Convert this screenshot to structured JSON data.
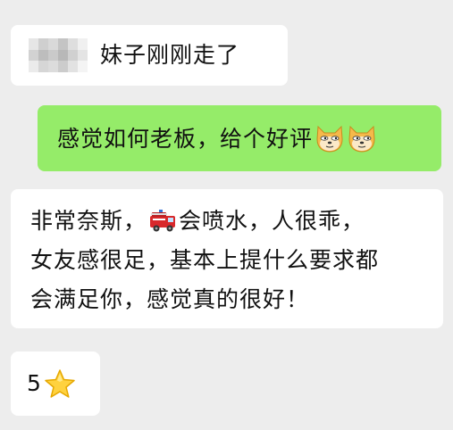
{
  "messages": [
    {
      "id": "msg1",
      "direction": "incoming",
      "sender_obscured": true,
      "text": "妹子刚刚走了"
    },
    {
      "id": "msg2",
      "direction": "outgoing",
      "text": "感觉如何老板，给个好评",
      "emojis": [
        "doge-icon",
        "doge-icon"
      ]
    },
    {
      "id": "msg3",
      "direction": "incoming",
      "lines": [
        {
          "before": "非常奈斯，",
          "emoji": "fire-truck-icon",
          "after": "会喷水，人很乖，"
        },
        {
          "text": "女友感很足，基本上提什么要求都"
        },
        {
          "text": "会满足你，感觉真的很好！"
        }
      ]
    },
    {
      "id": "msg4",
      "direction": "incoming",
      "text": "5",
      "emoji": "star-icon"
    }
  ],
  "colors": {
    "background": "#ededed",
    "incoming_bubble": "#ffffff",
    "outgoing_bubble": "#95ec69",
    "text": "#111111"
  }
}
